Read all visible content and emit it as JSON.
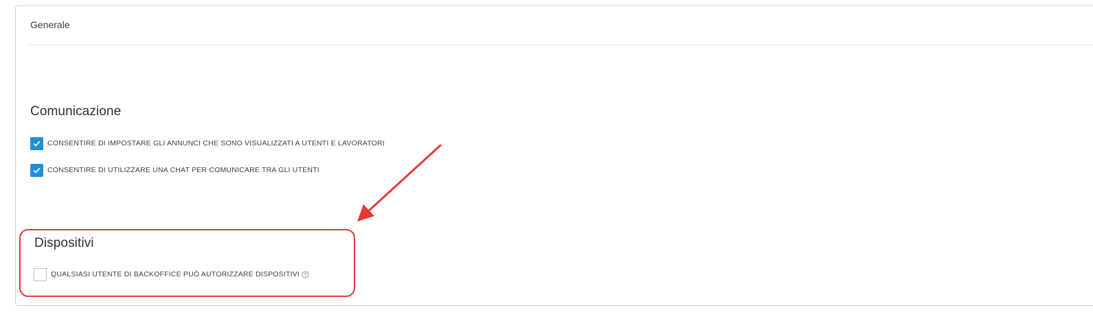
{
  "tab": {
    "label": "Generale"
  },
  "sections": {
    "communication": {
      "title": "Comunicazione",
      "options": [
        {
          "label": "CONSENTIRE DI IMPOSTARE GLI ANNUNCI CHE SONO VISUALIZZATI A UTENTI E  LAVORATORI",
          "checked": true
        },
        {
          "label": "CONSENTIRE DI UTILIZZARE UNA CHAT PER COMUNICARE TRA GLI UTENTI",
          "checked": true
        }
      ]
    },
    "devices": {
      "title": "Dispositivi",
      "options": [
        {
          "label": "QUALSIASI UTENTE DI BACKOFFICE PUÒ AUTORIZZARE DISPOSITIVI",
          "checked": false,
          "help_icon": "question-circle-icon"
        }
      ]
    }
  },
  "annotation": {
    "color": "#e53935",
    "arrow_icon": "red-arrow-icon"
  },
  "colors": {
    "checkbox_accent": "#1e8fd6",
    "border": "#cfd3d8"
  }
}
